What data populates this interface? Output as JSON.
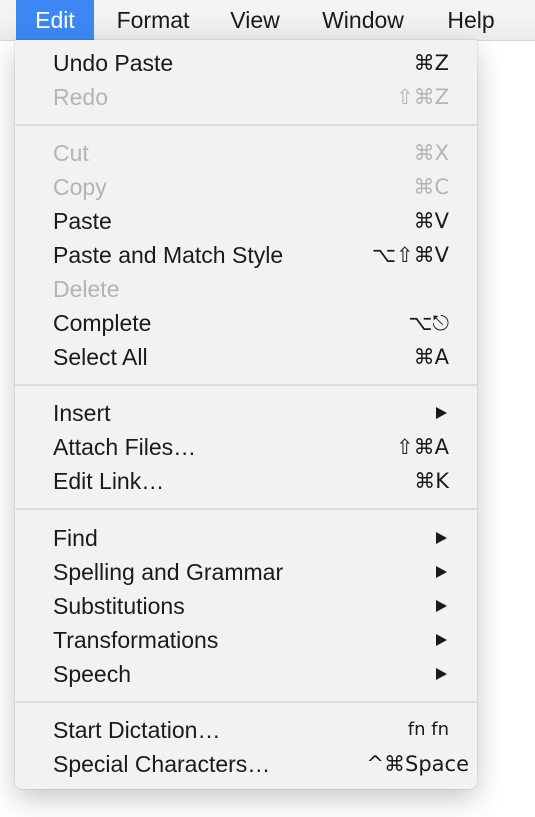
{
  "menubar": {
    "items": [
      {
        "label": "Edit",
        "active": true
      },
      {
        "label": "Format"
      },
      {
        "label": "View"
      },
      {
        "label": "Window"
      },
      {
        "label": "Help"
      }
    ]
  },
  "menu": {
    "groups": [
      [
        {
          "label": "Undo Paste",
          "shortcut": "⌘Z",
          "enabled": true
        },
        {
          "label": "Redo",
          "shortcut": "⇧⌘Z",
          "enabled": false
        }
      ],
      [
        {
          "label": "Cut",
          "shortcut": "⌘X",
          "enabled": false
        },
        {
          "label": "Copy",
          "shortcut": "⌘C",
          "enabled": false
        },
        {
          "label": "Paste",
          "shortcut": "⌘V",
          "enabled": true
        },
        {
          "label": "Paste and Match Style",
          "shortcut": "⌥⇧⌘V",
          "enabled": true
        },
        {
          "label": "Delete",
          "shortcut": "",
          "enabled": false
        },
        {
          "label": "Complete",
          "shortcut": "⌥⎋",
          "enabled": true
        },
        {
          "label": "Select All",
          "shortcut": "⌘A",
          "enabled": true
        }
      ],
      [
        {
          "label": "Insert",
          "submenu": true,
          "enabled": true
        },
        {
          "label": "Attach Files…",
          "shortcut": "⇧⌘A",
          "enabled": true
        },
        {
          "label": "Edit Link…",
          "shortcut": "⌘K",
          "enabled": true
        }
      ],
      [
        {
          "label": "Find",
          "submenu": true,
          "enabled": true
        },
        {
          "label": "Spelling and Grammar",
          "submenu": true,
          "enabled": true
        },
        {
          "label": "Substitutions",
          "submenu": true,
          "enabled": true
        },
        {
          "label": "Transformations",
          "submenu": true,
          "enabled": true
        },
        {
          "label": "Speech",
          "submenu": true,
          "enabled": true
        }
      ],
      [
        {
          "label": "Start Dictation…",
          "shortcut": "fn fn",
          "enabled": true
        },
        {
          "label": "Special Characters…",
          "shortcut": "^⌘Space",
          "enabled": true
        }
      ]
    ]
  },
  "colors": {
    "highlight": "#3d87f5",
    "disabled_text": "#b4b4b4"
  }
}
